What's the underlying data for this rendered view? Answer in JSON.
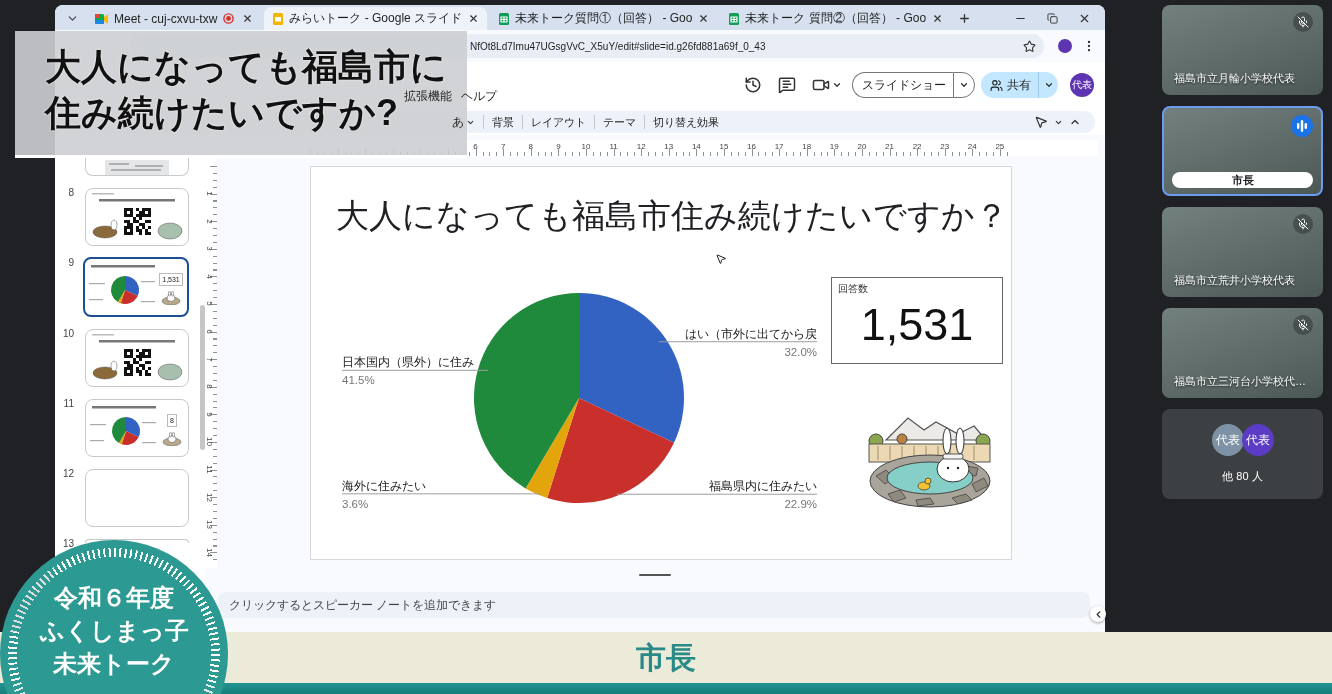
{
  "caption": {
    "lines": [
      "大人になっても福島市に",
      "住み続けたいですか?"
    ]
  },
  "browser": {
    "tabs": [
      {
        "title": "Meet - cuj-cxvu-txw",
        "kind": "meet",
        "recording": true,
        "selected": false
      },
      {
        "title": "みらいトーク - Google スライド",
        "kind": "slides",
        "recording": false,
        "selected": true
      },
      {
        "title": "未来トーク質問①（回答） - Goo",
        "kind": "sheets",
        "recording": false,
        "selected": false
      },
      {
        "title": "未来トーク 質問②（回答） - Goo",
        "kind": "sheets",
        "recording": false,
        "selected": false
      }
    ],
    "url": "NfOt8Ld7Imu47UGsgVvC_X5uY/edit#slide=id.g26fd881a69f_0_43"
  },
  "slides_app": {
    "menu": [
      "拡張機能",
      "ヘルプ"
    ],
    "slideshow_button": "スライドショー",
    "share_button": "共有",
    "user_avatar": "代表"
  },
  "toolbar": {
    "input_tool": "あ",
    "buttons": [
      "背景",
      "レイアウト",
      "テーマ",
      "切り替え効果"
    ]
  },
  "rulers": {
    "horizontal": [
      "6",
      "7",
      "8",
      "9",
      "10",
      "11",
      "12",
      "13",
      "14",
      "15",
      "16",
      "17",
      "18",
      "19",
      "20",
      "21",
      "22",
      "23",
      "24",
      "25"
    ],
    "vertical": [
      "1",
      "2",
      "3",
      "4",
      "5",
      "6",
      "7",
      "8",
      "9",
      "10",
      "11",
      "12",
      "13",
      "14"
    ]
  },
  "filmstrip": [
    {
      "kind": "photo",
      "selected": false
    },
    {
      "number": "8",
      "kind": "qr",
      "selected": false
    },
    {
      "number": "9",
      "kind": "pie",
      "count": "1,531",
      "selected": true
    },
    {
      "number": "10",
      "kind": "qr",
      "selected": false
    },
    {
      "number": "11",
      "kind": "pie",
      "count": "8",
      "selected": false
    },
    {
      "number": "12",
      "kind": "blank",
      "selected": false
    },
    {
      "number": "13",
      "kind": "blank",
      "selected": false
    }
  ],
  "slide": {
    "title": "大人になっても福島市住み続けたいですか？",
    "chart_data": {
      "type": "pie",
      "categories": [
        "はい（市外に出てから戻",
        "福島県内に住みたい",
        "海外に住みたい",
        "日本国内（県外）に住み"
      ],
      "values": [
        32.0,
        22.9,
        3.6,
        41.5
      ],
      "value_labels": [
        "32.0%",
        "22.9%",
        "3.6%",
        "41.5%"
      ]
    },
    "count_card": {
      "label": "回答数",
      "value": "1,531"
    }
  },
  "notes": {
    "placeholder": "クリックするとスピーカー ノートを追加できます"
  },
  "participants": [
    {
      "kind": "video",
      "name": "福島市立月輪小学校代表",
      "muted": true,
      "speaking": false
    },
    {
      "kind": "video",
      "name": "市長",
      "muted": false,
      "speaking": true
    },
    {
      "kind": "video",
      "name": "福島市立荒井小学校代表",
      "muted": true,
      "speaking": false
    },
    {
      "kind": "video",
      "name": "福島市立三河台小学校代…",
      "muted": true,
      "speaking": false
    },
    {
      "kind": "others",
      "avatars": [
        {
          "initials": "代表",
          "color": "#7e92a6"
        },
        {
          "initials": "代表",
          "color": "#5b3cc4"
        }
      ],
      "label": "他 80 人"
    }
  ],
  "banner": {
    "speaker": "市長"
  },
  "logo": {
    "lines": [
      "令和６年度",
      "ふくしまっ子",
      "未来トーク"
    ]
  }
}
